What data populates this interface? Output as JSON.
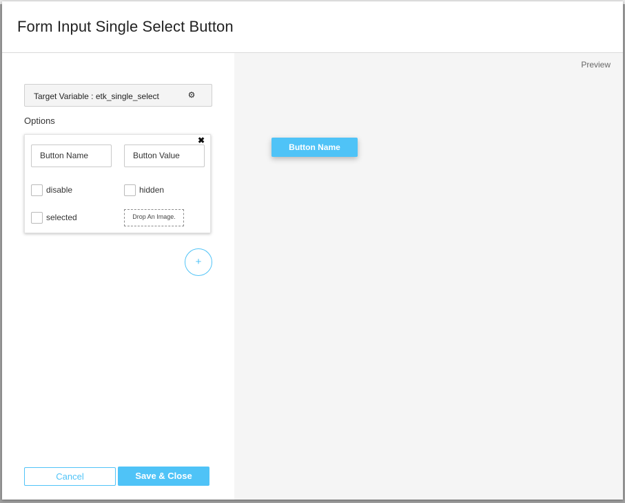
{
  "modal": {
    "title": "Form Input Single Select Button"
  },
  "config": {
    "target_variable_label": "Target Variable : etk_single_select",
    "settings_icon": "gear-icon",
    "options_label": "Options"
  },
  "option": {
    "close_icon": "close-icon",
    "button_name_value": "Button Name",
    "button_value_value": "Button Value",
    "disable_label": "disable",
    "hidden_label": "hidden",
    "selected_label": "selected",
    "drop_image_label": "Drop An Image."
  },
  "actions": {
    "add_label": "+",
    "cancel_label": "Cancel",
    "save_label": "Save & Close"
  },
  "preview": {
    "label": "Preview",
    "button_label": "Button Name"
  },
  "colors": {
    "accent": "#4fc3f7",
    "preview_bg": "#f5f5f5"
  }
}
